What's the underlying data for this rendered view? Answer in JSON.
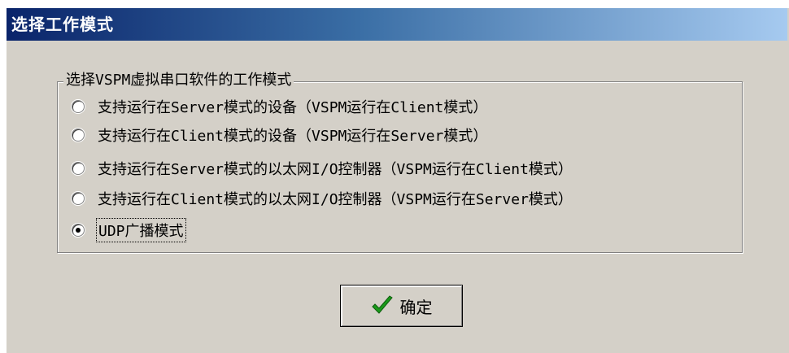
{
  "window": {
    "title": "选择工作模式"
  },
  "group": {
    "legend": "选择VSPM虚拟串口软件的工作模式",
    "options": [
      {
        "label": "支持运行在Server模式的设备（VSPM运行在Client模式）",
        "checked": false
      },
      {
        "label": "支持运行在Client模式的设备（VSPM运行在Server模式）",
        "checked": false
      },
      {
        "label": "支持运行在Server模式的以太网I/O控制器（VSPM运行在Client模式）",
        "checked": false
      },
      {
        "label": "支持运行在Client模式的以太网I/O控制器（VSPM运行在Server模式）",
        "checked": false
      },
      {
        "label": "UDP广播模式",
        "checked": true
      }
    ]
  },
  "buttons": {
    "ok_label": "确定",
    "ok_icon": "green-checkmark-icon"
  },
  "colors": {
    "title_start": "#0a246a",
    "title_end": "#a6caf0",
    "face": "#d4d0c8",
    "check_green": "#1a9a1a"
  }
}
